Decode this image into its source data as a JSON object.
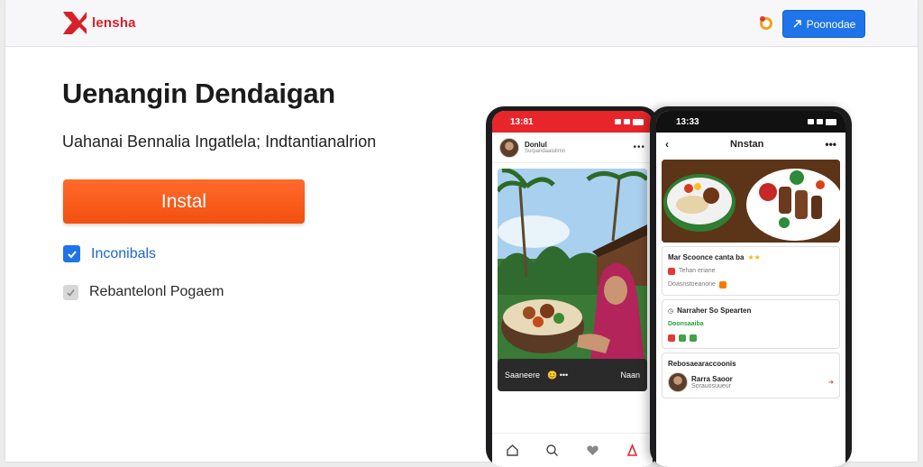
{
  "header": {
    "brand": "lensha",
    "button_label": "Poonodae"
  },
  "hero": {
    "title": "Uenangin Dendaigan",
    "subtitle": "Uahanai Bennalia Ingatlela; Indtantianalrion",
    "install_label": "Instal",
    "options": [
      {
        "label": "Inconibals",
        "checked": true
      },
      {
        "label": "Rebantelonl Pogaem",
        "checked": false
      }
    ]
  },
  "phone_left": {
    "time": "13:81",
    "post_user": "Donlul",
    "post_handle": "Surpandaaiulimn",
    "caption": "Saaneere",
    "caption_right": "Naan"
  },
  "phone_right": {
    "time": "13:33",
    "title": "Nnstan",
    "card1_title": "Mar Scoonce canta ba",
    "card1_line2": "Tehan eriane",
    "card1_line3": "Doasnstoeanone",
    "card2_title": "Narraher So Spearten",
    "card2_sub": "Doonsaaiba",
    "section_title": "Rebosaearaccoonis",
    "profile_name": "Rarra Saoor",
    "profile_handle": "Sorauosuueur"
  },
  "colors": {
    "accent_blue": "#1e74e8",
    "install_orange": "#f45a17",
    "brand_red": "#d8202a"
  }
}
